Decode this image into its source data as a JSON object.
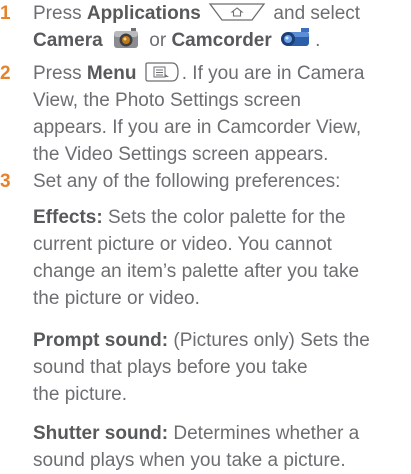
{
  "steps": [
    {
      "number": "1",
      "line1_a": "Press ",
      "line1_b": "Applications",
      "line1_c": " and select",
      "line2_a": "Camera",
      "line2_b": " or ",
      "line2_c": "Camcorder",
      "line2_d": "."
    },
    {
      "number": "2",
      "line1_a": "Press ",
      "line1_b": "Menu",
      "line1_c": ". If you are in Camera",
      "line2": "View, the Photo Settings screen",
      "line3": "appears. If you are in Camcorder View,",
      "line4": "the Video Settings screen appears."
    },
    {
      "number": "3",
      "line1": "Set any of the following preferences:"
    }
  ],
  "preferences": [
    {
      "term": "Effects:",
      "lines": [
        " Sets the color palette for the",
        "current picture or video. You cannot",
        "change an item’s palette after you take",
        "the picture or video."
      ]
    },
    {
      "term": "Prompt sound:",
      "lines": [
        " (Pictures only) Sets the",
        "sound that plays before you take",
        "the picture."
      ]
    },
    {
      "term": "Shutter sound:",
      "lines": [
        " Determines whether a",
        "sound plays when you take a picture."
      ]
    }
  ],
  "colors": {
    "step_number": "#e6822b",
    "body_text": "#6d6e71",
    "bold_text": "#58595b"
  },
  "icons": [
    "applications-key-icon",
    "camera-app-icon",
    "camcorder-app-icon",
    "menu-key-icon"
  ]
}
